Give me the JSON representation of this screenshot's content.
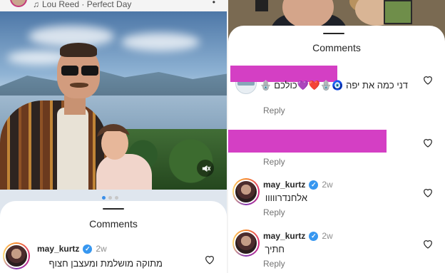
{
  "left": {
    "music": {
      "text": "Lou Reed · Perfect Day",
      "icon": "music-note-icon"
    },
    "sheet": {
      "title": "Comments"
    },
    "comments": [
      {
        "username": "may_kurtz",
        "time": "2w",
        "text": "מתוקה מושלמת ומעצבן חצוף"
      }
    ]
  },
  "right": {
    "sheet": {
      "title": "Comments"
    },
    "comments": [
      {
        "text": "דני כמה את יפה 🧿🪬❤️💜כולכם 🪬",
        "reply": "Reply"
      },
      {
        "reply": "Reply"
      },
      {
        "username": "may_kurtz",
        "time": "2w",
        "text": "אלחנדרווווו",
        "reply": "Reply"
      },
      {
        "username": "may_kurtz",
        "time": "2w",
        "text": "חתיך",
        "reply": "Reply"
      }
    ]
  },
  "colors": {
    "verified": "#3797f0",
    "redaction": "#d43fc4",
    "pagination_active": "#3a8ee8"
  },
  "carousel": {
    "pages": 3,
    "active_index": 0
  }
}
